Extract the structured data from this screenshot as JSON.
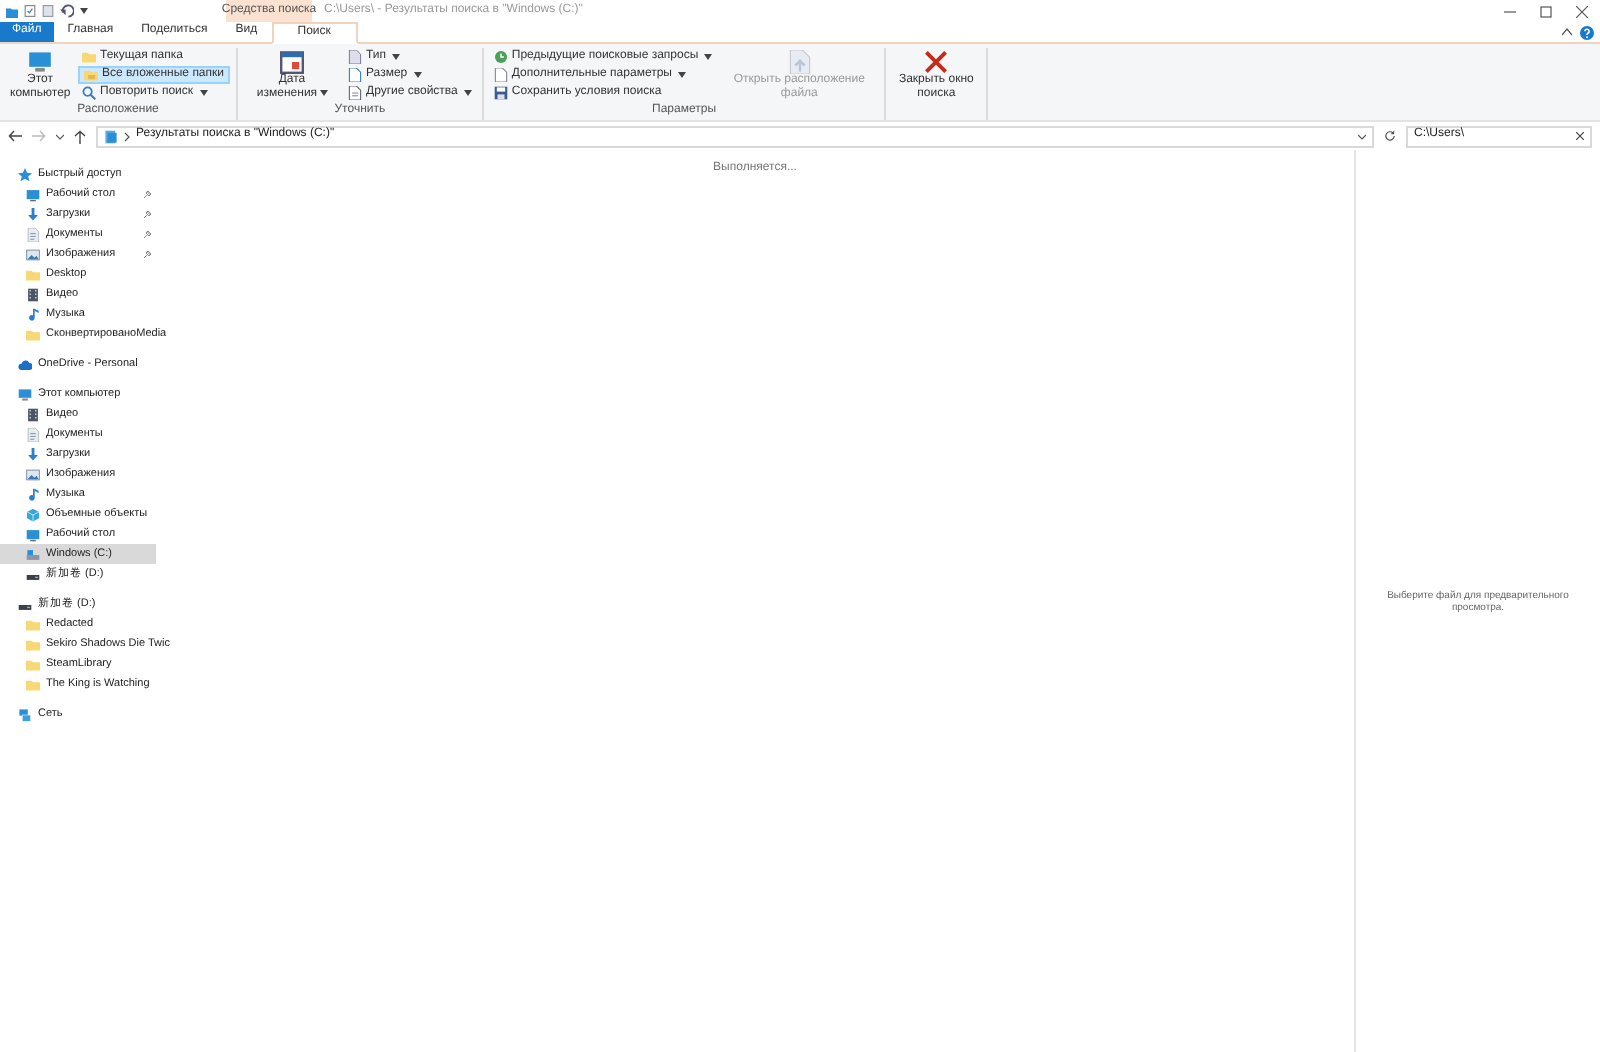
{
  "title_bar": {
    "contextual_tab": "Средства поиска",
    "title": "C:\\Users\\ - Результаты поиска в \"Windows (C:)\""
  },
  "tabs": [
    {
      "label": "Файл",
      "kind": "file",
      "selected": false
    },
    {
      "label": "Главная",
      "kind": "tab",
      "selected": false
    },
    {
      "label": "Поделиться",
      "kind": "tab",
      "selected": false
    },
    {
      "label": "Вид",
      "kind": "tab",
      "selected": false
    },
    {
      "label": "Поиск",
      "kind": "contextual",
      "selected": true
    }
  ],
  "ribbon": [
    {
      "label": "Расположение",
      "columns": [
        [
          {
            "label": "Этот компьютер",
            "kind": "computer"
          }
        ],
        [
          {
            "label": "Текущая папка",
            "kind": "folder",
            "selected": false
          },
          {
            "label": "Все вложенные папки",
            "kind": "subfolders",
            "selected": true
          },
          {
            "label": "Повторить поиск",
            "kind": "research",
            "selected": false,
            "dropdown": true
          }
        ]
      ]
    },
    {
      "label": "Уточнить",
      "columns": [
        [
          {
            "label": "Дата изменения",
            "kind": "calendar",
            "dropdown": true
          }
        ],
        [
          {
            "label": "Тип",
            "kind": "type",
            "dropdown": true
          },
          {
            "label": "Размер",
            "kind": "size",
            "dropdown": true
          },
          {
            "label": "Другие свойства",
            "kind": "props",
            "dropdown": true
          }
        ]
      ]
    },
    {
      "label": "Параметры",
      "columns": [
        [
          {
            "label": "Предыдущие поисковые запросы",
            "kind": "history",
            "dropdown": true
          },
          {
            "label": "Дополнительные параметры",
            "kind": "options",
            "dropdown": true
          },
          {
            "label": "Сохранить условия поиска",
            "kind": "save"
          }
        ],
        [
          {
            "label": "Открыть расположение файла",
            "kind": "openloc",
            "disabled": true
          }
        ]
      ]
    },
    {
      "columns": [
        [
          {
            "label": "Закрыть окно поиска",
            "kind": "close"
          }
        ]
      ]
    }
  ],
  "address": {
    "path": "Результаты поиска в \"Windows (C:)\"",
    "search_value": "C:\\Users\\"
  },
  "navigation": [
    {
      "label": "Быстрый доступ",
      "kind": "quick",
      "selected": false,
      "children": [
        {
          "label": "Рабочий стол",
          "kind": "desktop",
          "pinned": true,
          "selected": false
        },
        {
          "label": "Загрузки",
          "kind": "download",
          "pinned": true,
          "selected": false
        },
        {
          "label": "Документы",
          "kind": "docs",
          "pinned": true,
          "selected": false
        },
        {
          "label": "Изображения",
          "kind": "pics",
          "pinned": true,
          "selected": false
        },
        {
          "label": "Desktop",
          "kind": "folder",
          "pinned": false,
          "selected": false
        },
        {
          "label": "Видео",
          "kind": "video",
          "pinned": false,
          "selected": false
        },
        {
          "label": "Музыка",
          "kind": "music",
          "pinned": false,
          "selected": false
        },
        {
          "label": "СконвертированоMedia",
          "kind": "folder",
          "pinned": false,
          "selected": false
        }
      ]
    },
    {
      "label": "OneDrive - Personal",
      "kind": "cloud",
      "selected": false
    },
    {
      "label": "Этот компьютер",
      "kind": "computer",
      "selected": false,
      "children": [
        {
          "label": "Видео",
          "kind": "video",
          "selected": false
        },
        {
          "label": "Документы",
          "kind": "docs",
          "selected": false
        },
        {
          "label": "Загрузки",
          "kind": "download",
          "selected": false
        },
        {
          "label": "Изображения",
          "kind": "pics",
          "selected": false
        },
        {
          "label": "Музыка",
          "kind": "music",
          "selected": false
        },
        {
          "label": "Объемные объекты",
          "kind": "objects",
          "selected": false
        },
        {
          "label": "Рабочий стол",
          "kind": "desktop",
          "selected": false
        },
        {
          "label": "Windows (C:)",
          "kind": "windrive",
          "selected": true
        },
        {
          "label": "新加卷 (D:)",
          "kind": "drive",
          "selected": false
        }
      ]
    },
    {
      "label": "新加卷 (D:)",
      "kind": "drive",
      "selected": false,
      "children": [
        {
          "label": "Redacted",
          "kind": "folder",
          "selected": false
        },
        {
          "label": "Sekiro Shadows Die Twic",
          "kind": "folder",
          "selected": false
        },
        {
          "label": "SteamLibrary",
          "kind": "folder",
          "selected": false
        },
        {
          "label": "The King is Watching",
          "kind": "folder",
          "selected": false
        }
      ]
    },
    {
      "label": "Сеть",
      "kind": "network",
      "selected": false
    }
  ],
  "content": {
    "status": "Выполняется..."
  },
  "preview": {
    "message": "Выберите файл для предварительного просмотра."
  }
}
